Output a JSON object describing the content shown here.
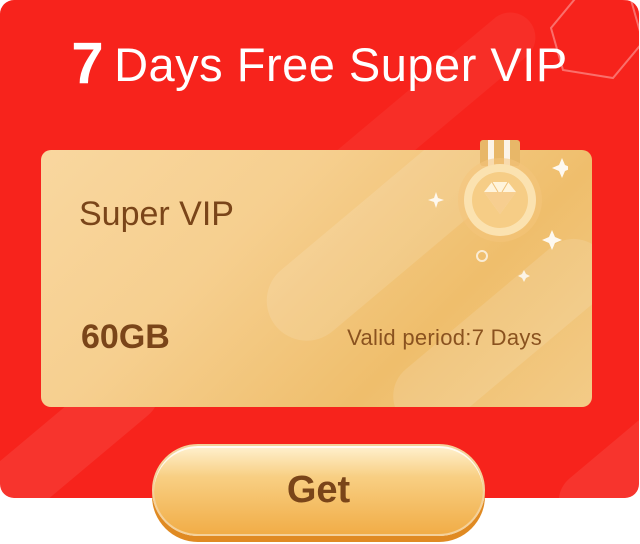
{
  "promo": {
    "headline_number": "7",
    "headline_text": "Days Free Super VIP"
  },
  "card": {
    "title": "Super VIP",
    "storage": "60GB",
    "validity": "Valid period:7 Days",
    "medal_icon": "diamond-medal-icon"
  },
  "actions": {
    "get_label": "Get"
  },
  "colors": {
    "background_red": "#f7231c",
    "card_gold": "#f6cf8f",
    "text_brown": "#7a4519"
  }
}
